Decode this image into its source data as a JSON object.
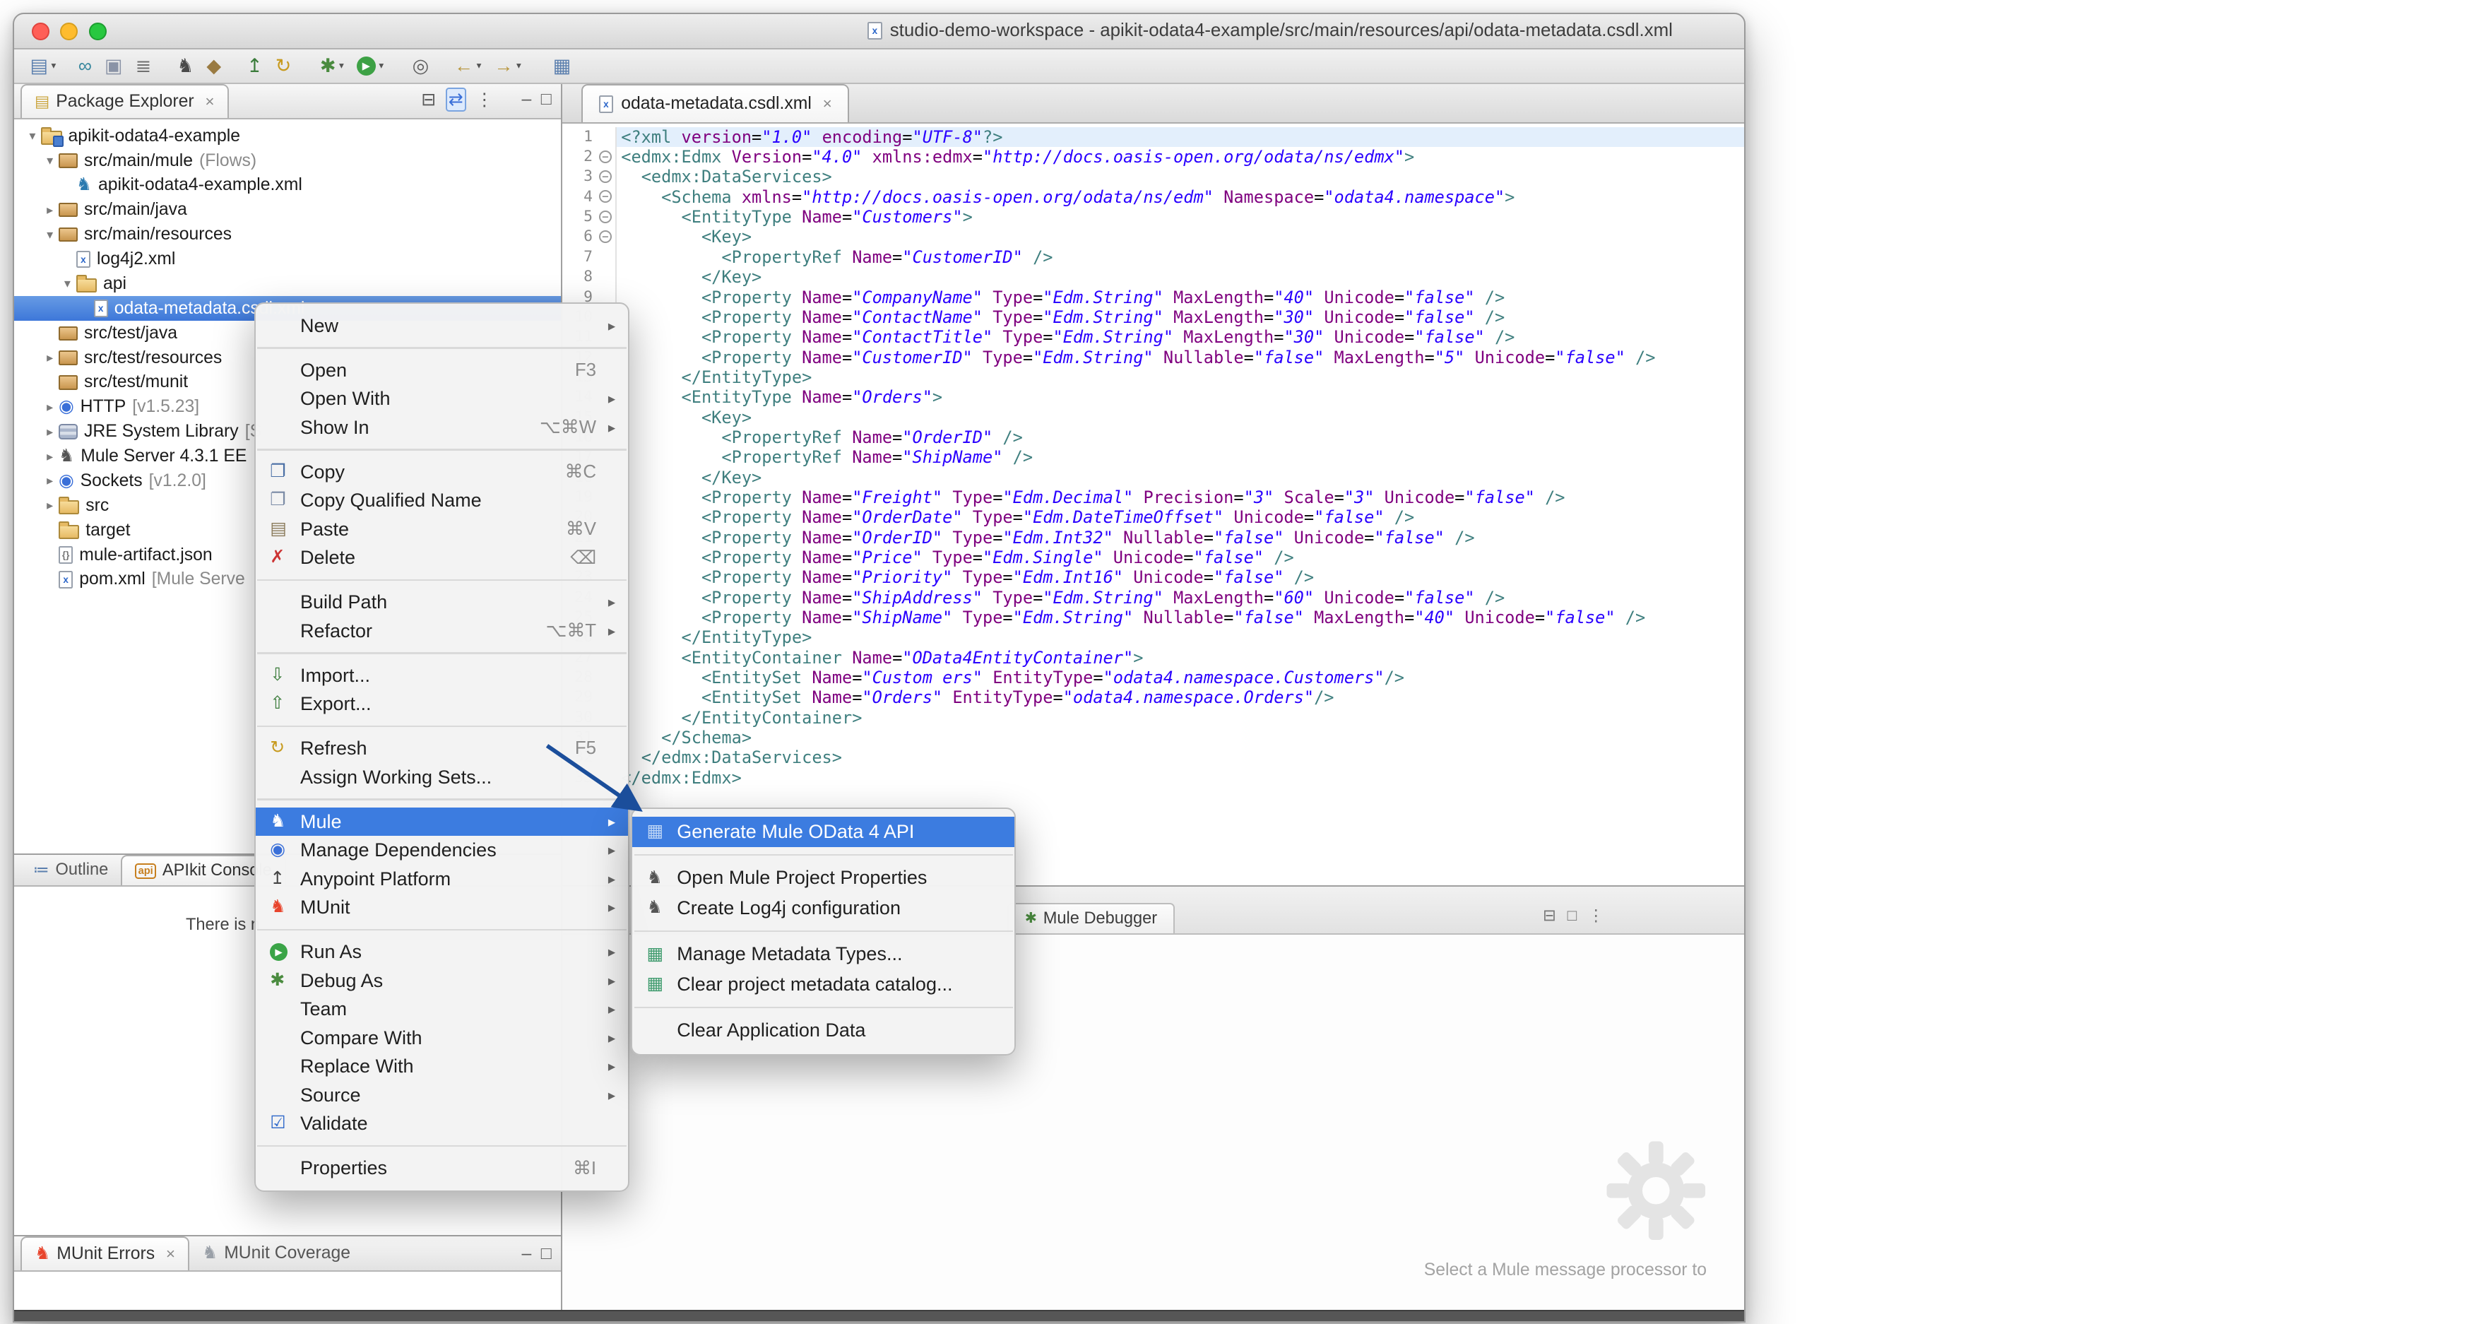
{
  "window": {
    "title": "studio-demo-workspace - apikit-odata4-example/src/main/resources/api/odata-metadata.csdl.xml"
  },
  "colors": {
    "selection_blue": "#3d77d9",
    "menu_highlight_blue": "#3c7ce0",
    "munit_red": "#e8442c",
    "annotation_arrow_blue": "#1b4e9b"
  },
  "toolbar": {
    "icons": [
      {
        "name": "new-wizard",
        "glyph": "▤",
        "color": "#5b7fae",
        "dd": true
      },
      {
        "name": "connect",
        "glyph": "∞",
        "color": "#39889e",
        "gap": 6
      },
      {
        "name": "save",
        "glyph": "▣",
        "color": "#8a93a6"
      },
      {
        "name": "print",
        "glyph": "≣",
        "color": "#6f6f6f"
      },
      {
        "name": "mule-project",
        "glyph": "♞",
        "color": "#4a4a4a",
        "gap": 8
      },
      {
        "name": "build",
        "glyph": "◆",
        "color": "#9a7b42"
      },
      {
        "name": "deploy",
        "glyph": "↥",
        "color": "#3a7b3a",
        "gap": 8
      },
      {
        "name": "refresh",
        "glyph": "↻",
        "color": "#c79a1e"
      },
      {
        "name": "debug",
        "glyph": "✱",
        "color": "#4a8b3f",
        "dd": true,
        "gap": 10
      },
      {
        "name": "run",
        "glyph": "▶",
        "bg": "#3da145",
        "dd": true
      },
      {
        "name": "search",
        "glyph": "◎",
        "color": "#5f5f5f",
        "gap": 10
      },
      {
        "name": "back",
        "glyph": "←",
        "color": "#b8963e",
        "dd": true,
        "gap": 8
      },
      {
        "name": "forward",
        "glyph": "→",
        "color": "#b8963e",
        "dd": true
      },
      {
        "name": "open-perspective",
        "glyph": "▦",
        "color": "#5b7fae",
        "gap": 12
      }
    ]
  },
  "package_explorer": {
    "tab_label": "Package Explorer",
    "tree": [
      {
        "label": "apikit-odata4-example",
        "depth": 0,
        "arrow": "v",
        "icon": "project"
      },
      {
        "label": "src/main/mule",
        "suffix": "(Flows)",
        "depth": 1,
        "arrow": "v",
        "icon": "package"
      },
      {
        "label": "apikit-odata4-example.xml",
        "depth": 2,
        "icon": "flow"
      },
      {
        "label": "src/main/java",
        "depth": 1,
        "arrow": ">",
        "icon": "package"
      },
      {
        "label": "src/main/resources",
        "depth": 1,
        "arrow": "v",
        "icon": "package"
      },
      {
        "label": "log4j2.xml",
        "depth": 2,
        "icon": "xml"
      },
      {
        "label": "api",
        "depth": 2,
        "arrow": "v",
        "icon": "folder"
      },
      {
        "label": "odata-metadata.csdl.xml",
        "depth": 3,
        "icon": "xml",
        "selected": true
      },
      {
        "label": "src/test/java",
        "depth": 1,
        "icon": "package"
      },
      {
        "label": "src/test/resources",
        "depth": 1,
        "arrow": ">",
        "icon": "package"
      },
      {
        "label": "src/test/munit",
        "depth": 1,
        "icon": "package"
      },
      {
        "label": "HTTP",
        "suffix": "[v1.5.23]",
        "depth": 1,
        "arrow": ">",
        "icon": "globe"
      },
      {
        "label": "JRE System Library",
        "suffix": "[S",
        "depth": 1,
        "arrow": ">",
        "icon": "lib"
      },
      {
        "label": "Mule Server 4.3.1 EE",
        "depth": 1,
        "arrow": ">",
        "icon": "mule-server"
      },
      {
        "label": "Sockets",
        "suffix": "[v1.2.0]",
        "depth": 1,
        "arrow": ">",
        "icon": "globe"
      },
      {
        "label": "src",
        "depth": 1,
        "arrow": ">",
        "icon": "folder"
      },
      {
        "label": "target",
        "depth": 1,
        "icon": "folder"
      },
      {
        "label": "mule-artifact.json",
        "depth": 1,
        "icon": "json"
      },
      {
        "label": "pom.xml",
        "suffix": "[Mule Serve",
        "depth": 1,
        "icon": "xml"
      }
    ]
  },
  "editor": {
    "tab_label": "odata-metadata.csdl.xml",
    "current_line": 1,
    "fold_lines": [
      2,
      3,
      4,
      5,
      6
    ],
    "lines": [
      "<?xml version=\"1.0\" encoding=\"UTF-8\"?>",
      "<edmx:Edmx Version=\"4.0\" xmlns:edmx=\"http://docs.oasis-open.org/odata/ns/edmx\">",
      "  <edmx:DataServices>",
      "    <Schema xmlns=\"http://docs.oasis-open.org/odata/ns/edm\" Namespace=\"odata4.namespace\">",
      "      <EntityType Name=\"Customers\">",
      "        <Key>",
      "          <PropertyRef Name=\"CustomerID\" />",
      "        </Key>",
      "        <Property Name=\"CompanyName\" Type=\"Edm.String\" MaxLength=\"40\" Unicode=\"false\" />",
      "        <Property Name=\"ContactName\" Type=\"Edm.String\" MaxLength=\"30\" Unicode=\"false\" />",
      "        <Property Name=\"ContactTitle\" Type=\"Edm.String\" MaxLength=\"30\" Unicode=\"false\" />",
      "        <Property Name=\"CustomerID\" Type=\"Edm.String\" Nullable=\"false\" MaxLength=\"5\" Unicode=\"false\" />",
      "      </EntityType>",
      "      <EntityType Name=\"Orders\">",
      "        <Key>",
      "          <PropertyRef Name=\"OrderID\" />",
      "          <PropertyRef Name=\"ShipName\" />",
      "        </Key>",
      "        <Property Name=\"Freight\" Type=\"Edm.Decimal\" Precision=\"3\" Scale=\"3\" Unicode=\"false\" />",
      "        <Property Name=\"OrderDate\" Type=\"Edm.DateTimeOffset\" Unicode=\"false\" />",
      "        <Property Name=\"OrderID\" Type=\"Edm.Int32\" Nullable=\"false\" Unicode=\"false\" />",
      "        <Property Name=\"Price\" Type=\"Edm.Single\" Unicode=\"false\" />",
      "        <Property Name=\"Priority\" Type=\"Edm.Int16\" Unicode=\"false\" />",
      "        <Property Name=\"ShipAddress\" Type=\"Edm.String\" MaxLength=\"60\" Unicode=\"false\" />",
      "        <Property Name=\"ShipName\" Type=\"Edm.String\" Nullable=\"false\" MaxLength=\"40\" Unicode=\"false\" />",
      "      </EntityType>",
      "      <EntityContainer Name=\"OData4EntityContainer\">",
      "        <EntitySet Name=\"Custom ers\" EntityType=\"odata4.namespace.Customers\"/>",
      "        <EntitySet Name=\"Orders\" EntityType=\"odata4.namespace.Orders\"/>",
      "      </EntityContainer>",
      "    </Schema>",
      "  </edmx:DataServices>",
      "</edmx:Edmx>"
    ]
  },
  "context_menu": {
    "items": [
      {
        "label": "New",
        "arrow": true
      },
      {
        "sep": true
      },
      {
        "label": "Open",
        "shortcut": "F3"
      },
      {
        "label": "Open With",
        "arrow": true
      },
      {
        "label": "Show In",
        "shortcut": "⌥⌘W",
        "arrow": true
      },
      {
        "sep": true
      },
      {
        "label": "Copy",
        "shortcut": "⌘C",
        "icon": "copy"
      },
      {
        "label": "Copy Qualified Name",
        "icon": "copy-qualified"
      },
      {
        "label": "Paste",
        "shortcut": "⌘V",
        "icon": "paste"
      },
      {
        "label": "Delete",
        "shortcut": "⌫",
        "icon": "delete"
      },
      {
        "sep": true
      },
      {
        "label": "Build Path",
        "arrow": true
      },
      {
        "label": "Refactor",
        "shortcut": "⌥⌘T",
        "arrow": true
      },
      {
        "sep": true
      },
      {
        "label": "Import...",
        "icon": "import"
      },
      {
        "label": "Export...",
        "icon": "export"
      },
      {
        "sep": true
      },
      {
        "label": "Refresh",
        "shortcut": "F5",
        "icon": "refresh"
      },
      {
        "label": "Assign Working Sets..."
      },
      {
        "sep": true
      },
      {
        "label": "Mule",
        "arrow": true,
        "icon": "mule",
        "highlighted": true
      },
      {
        "label": "Manage Dependencies",
        "arrow": true,
        "icon": "dependencies"
      },
      {
        "label": "Anypoint Platform",
        "arrow": true,
        "icon": "anypoint"
      },
      {
        "label": "MUnit",
        "arrow": true,
        "icon": "munit"
      },
      {
        "sep": true
      },
      {
        "label": "Run As",
        "arrow": true,
        "icon": "run"
      },
      {
        "label": "Debug As",
        "arrow": true,
        "icon": "debug"
      },
      {
        "label": "Team",
        "arrow": true
      },
      {
        "label": "Compare With",
        "arrow": true
      },
      {
        "label": "Replace With",
        "arrow": true
      },
      {
        "label": "Source",
        "arrow": true
      },
      {
        "label": "Validate",
        "icon": "validate"
      },
      {
        "sep": true
      },
      {
        "label": "Properties",
        "shortcut": "⌘I"
      }
    ]
  },
  "mule_submenu": {
    "items": [
      {
        "label": "Generate Mule OData 4 API",
        "icon": "odata",
        "highlighted": true
      },
      {
        "sep": true
      },
      {
        "label": "Open Mule Project Properties",
        "icon": "mule-gray"
      },
      {
        "label": "Create Log4j configuration",
        "icon": "mule-gray"
      },
      {
        "sep": true
      },
      {
        "label": "Manage Metadata Types...",
        "icon": "metadata"
      },
      {
        "label": "Clear project metadata catalog...",
        "icon": "metadata-clear"
      },
      {
        "sep": true
      },
      {
        "label": "Clear Application Data"
      }
    ]
  },
  "outline_view": {
    "tabs": [
      {
        "label": "Outline"
      },
      {
        "label": "APIkit Console",
        "badge": "api"
      }
    ],
    "message": "There is n"
  },
  "debugger_view": {
    "tab_label": "Mule Debugger",
    "placeholder": "Select a Mule message processor to"
  },
  "munit_view": {
    "tabs": [
      {
        "label": "MUnit Errors",
        "closable": true
      },
      {
        "label": "MUnit Coverage"
      }
    ]
  }
}
